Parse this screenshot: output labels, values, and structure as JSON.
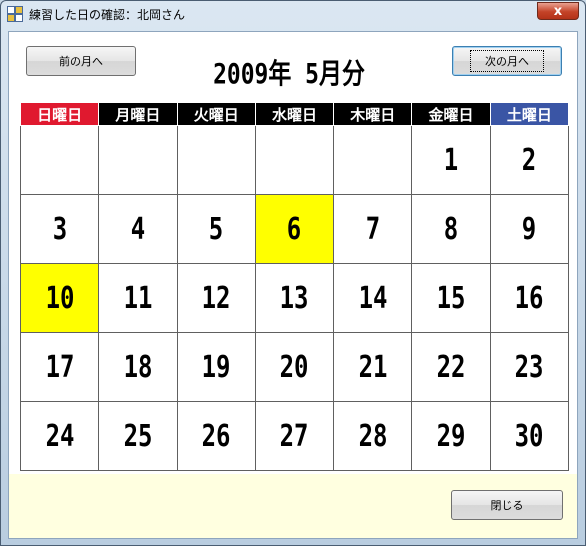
{
  "window": {
    "title": "練習した日の確認：北岡さん",
    "close_glyph": "x"
  },
  "nav": {
    "prev_label": "前の月へ",
    "next_label": "次の月へ"
  },
  "calendar": {
    "month_title": "2009年 5月分",
    "weekdays": [
      "日曜日",
      "月曜日",
      "火曜日",
      "水曜日",
      "木曜日",
      "金曜日",
      "土曜日"
    ],
    "weekday_colors": {
      "sunday": "#e0192f",
      "saturday": "#3a55a5",
      "weekday": "#000000"
    },
    "highlight_color": "#ffff00",
    "weeks": [
      [
        "",
        "",
        "",
        "",
        "",
        "1",
        "2"
      ],
      [
        "3",
        "4",
        "5",
        "6",
        "7",
        "8",
        "9"
      ],
      [
        "10",
        "11",
        "12",
        "13",
        "14",
        "15",
        "16"
      ],
      [
        "17",
        "18",
        "19",
        "20",
        "21",
        "22",
        "23"
      ],
      [
        "24",
        "25",
        "26",
        "27",
        "28",
        "29",
        "30"
      ]
    ],
    "highlighted_days": [
      "6",
      "10"
    ]
  },
  "footer": {
    "close_label": "閉じる"
  }
}
